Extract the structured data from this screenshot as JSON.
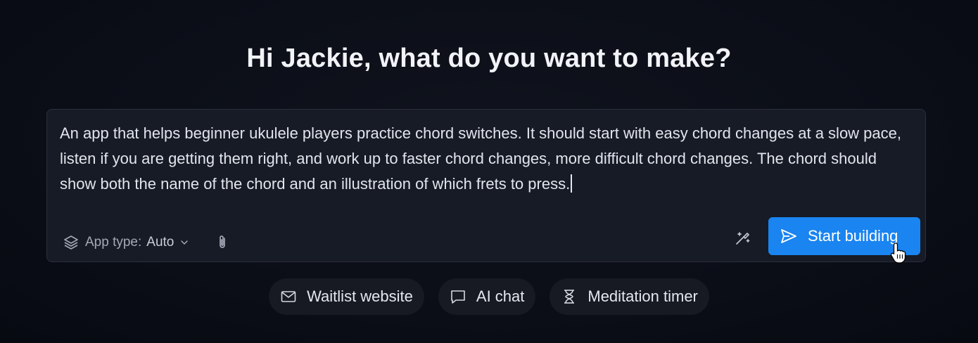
{
  "greeting": "Hi Jackie, what do you want to make?",
  "prompt": {
    "text": "An app that helps beginner ukulele players practice chord switches. It should start with easy chord changes at a slow pace, listen if you are getting them right, and work up to faster chord changes, more difficult chord changes. The chord should show both the name of the chord and an illustration of which frets to press."
  },
  "toolbar": {
    "app_type_label": "App type:",
    "app_type_value": "Auto",
    "layers_icon": "layers-icon",
    "attach_icon": "paperclip-icon",
    "enhance_icon": "magic-wand-icon",
    "start_label": "Start building",
    "start_icon": "send-icon",
    "accent_color": "#1a84f0"
  },
  "suggestions": [
    {
      "label": "Waitlist website",
      "icon": "mail-icon"
    },
    {
      "label": "AI chat",
      "icon": "chat-bubble-icon"
    },
    {
      "label": "Meditation timer",
      "icon": "hourglass-icon"
    }
  ]
}
